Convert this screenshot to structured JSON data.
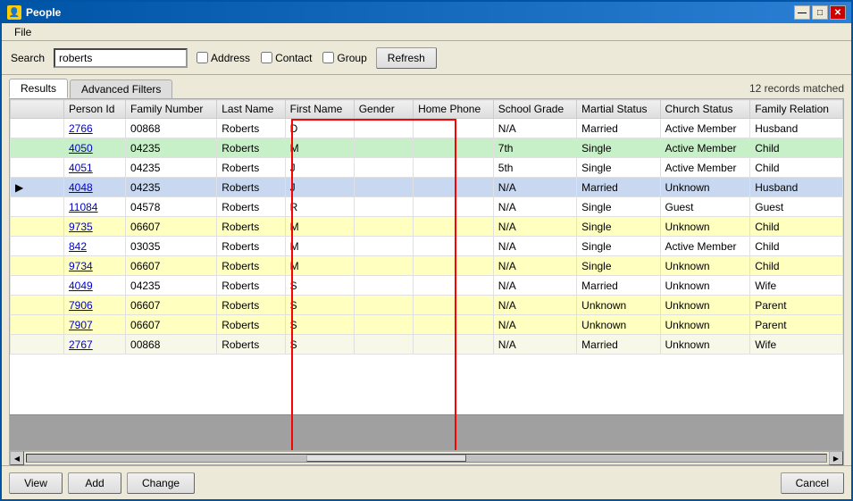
{
  "window": {
    "title": "People",
    "icon": "👤"
  },
  "title_buttons": {
    "minimize": "—",
    "maximize": "□",
    "close": "✕"
  },
  "menu": {
    "items": [
      "File"
    ]
  },
  "toolbar": {
    "search_label": "Search",
    "search_value": "roberts",
    "address_label": "Address",
    "contact_label": "Contact",
    "group_label": "Group",
    "refresh_label": "Refresh"
  },
  "tabs": {
    "results_label": "Results",
    "advanced_filters_label": "Advanced Filters"
  },
  "records_info": "12 records matched",
  "table": {
    "columns": [
      {
        "id": "indicator",
        "label": ""
      },
      {
        "id": "person_id",
        "label": "Person Id"
      },
      {
        "id": "family_number",
        "label": "Family Number"
      },
      {
        "id": "last_name",
        "label": "Last Name"
      },
      {
        "id": "first_name",
        "label": "First Name"
      },
      {
        "id": "gender",
        "label": "Gender"
      },
      {
        "id": "home_phone",
        "label": "Home Phone"
      },
      {
        "id": "school_grade",
        "label": "School Grade"
      },
      {
        "id": "marital_status",
        "label": "Martial Status"
      },
      {
        "id": "church_status",
        "label": "Church Status"
      },
      {
        "id": "family_relation",
        "label": "Family Relation"
      }
    ],
    "rows": [
      {
        "indicator": "",
        "person_id": "2766",
        "family_number": "00868",
        "last_name": "Roberts",
        "first_name": "D",
        "gender": "",
        "home_phone": "",
        "school_grade": "N/A",
        "marital_status": "Married",
        "church_status": "Active Member",
        "family_relation": "Husband",
        "style": "normal"
      },
      {
        "indicator": "",
        "person_id": "4050",
        "family_number": "04235",
        "last_name": "Roberts",
        "first_name": "M",
        "gender": "",
        "home_phone": "",
        "school_grade": "7th",
        "marital_status": "Single",
        "church_status": "Active Member",
        "family_relation": "Child",
        "style": "green"
      },
      {
        "indicator": "",
        "person_id": "4051",
        "family_number": "04235",
        "last_name": "Roberts",
        "first_name": "J",
        "gender": "",
        "home_phone": "",
        "school_grade": "5th",
        "marital_status": "Single",
        "church_status": "Active Member",
        "family_relation": "Child",
        "style": "normal"
      },
      {
        "indicator": "▶",
        "person_id": "4048",
        "family_number": "04235",
        "last_name": "Roberts",
        "first_name": "J",
        "gender": "",
        "home_phone": "",
        "school_grade": "N/A",
        "marital_status": "Married",
        "church_status": "Unknown",
        "family_relation": "Husband",
        "style": "selected"
      },
      {
        "indicator": "",
        "person_id": "11084",
        "family_number": "04578",
        "last_name": "Roberts",
        "first_name": "R",
        "gender": "",
        "home_phone": "",
        "school_grade": "N/A",
        "marital_status": "Single",
        "church_status": "Guest",
        "family_relation": "Guest",
        "style": "normal"
      },
      {
        "indicator": "",
        "person_id": "9735",
        "family_number": "06607",
        "last_name": "Roberts",
        "first_name": "M",
        "gender": "",
        "home_phone": "",
        "school_grade": "N/A",
        "marital_status": "Single",
        "church_status": "Unknown",
        "family_relation": "Child",
        "style": "yellow"
      },
      {
        "indicator": "",
        "person_id": "842",
        "family_number": "03035",
        "last_name": "Roberts",
        "first_name": "M",
        "gender": "",
        "home_phone": "",
        "school_grade": "N/A",
        "marital_status": "Single",
        "church_status": "Active Member",
        "family_relation": "Child",
        "style": "normal"
      },
      {
        "indicator": "",
        "person_id": "9734",
        "family_number": "06607",
        "last_name": "Roberts",
        "first_name": "M",
        "gender": "",
        "home_phone": "",
        "school_grade": "N/A",
        "marital_status": "Single",
        "church_status": "Unknown",
        "family_relation": "Child",
        "style": "yellow"
      },
      {
        "indicator": "",
        "person_id": "4049",
        "family_number": "04235",
        "last_name": "Roberts",
        "first_name": "S",
        "gender": "",
        "home_phone": "",
        "school_grade": "N/A",
        "marital_status": "Married",
        "church_status": "Unknown",
        "family_relation": "Wife",
        "style": "normal"
      },
      {
        "indicator": "",
        "person_id": "7906",
        "family_number": "06607",
        "last_name": "Roberts",
        "first_name": "S",
        "gender": "",
        "home_phone": "",
        "school_grade": "N/A",
        "marital_status": "Unknown",
        "church_status": "Unknown",
        "family_relation": "Parent",
        "style": "yellow"
      },
      {
        "indicator": "",
        "person_id": "7907",
        "family_number": "06607",
        "last_name": "Roberts",
        "first_name": "S",
        "gender": "",
        "home_phone": "",
        "school_grade": "N/A",
        "marital_status": "Unknown",
        "church_status": "Unknown",
        "family_relation": "Parent",
        "style": "yellow"
      },
      {
        "indicator": "",
        "person_id": "2767",
        "family_number": "00868",
        "last_name": "Roberts",
        "first_name": "S",
        "gender": "",
        "home_phone": "",
        "school_grade": "N/A",
        "marital_status": "Married",
        "church_status": "Unknown",
        "family_relation": "Wife",
        "style": "normal"
      }
    ]
  },
  "bottom_buttons": {
    "view_label": "View",
    "add_label": "Add",
    "change_label": "Change",
    "cancel_label": "Cancel"
  }
}
